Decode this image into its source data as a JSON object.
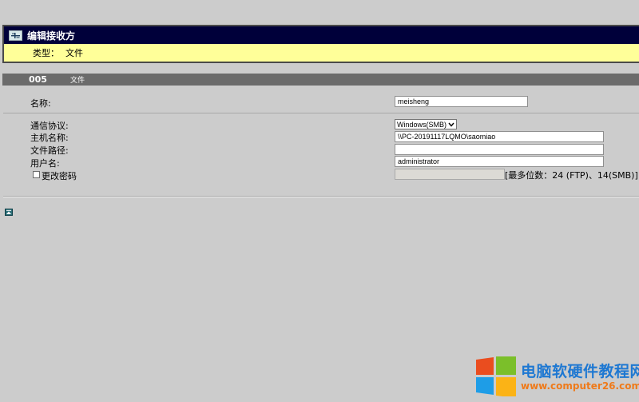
{
  "header": {
    "title": "编辑接收方",
    "type_label": "类型：",
    "type_value": "文件"
  },
  "section": {
    "number": "005",
    "kind": "文件"
  },
  "form": {
    "name_label": "名称:",
    "name_value": "meisheng",
    "protocol_label": "通信协议:",
    "protocol_value": "Windows(SMB)",
    "host_label": "主机名称:",
    "host_value": "\\\\PC-20191117LQMO\\saomiao",
    "path_label": "文件路径:",
    "path_value": "",
    "user_label": "用户名:",
    "user_value": "administrator",
    "change_password_label": "更改密码",
    "password_value": "",
    "password_hint": "[最多位数：24 (FTP)、14(SMB)]"
  },
  "watermark": {
    "title": "电脑软硬件教程网",
    "url": "www.computer26.com",
    "colors": {
      "title": "#1e78d2",
      "url": "#ef7a1a"
    }
  },
  "colors": {
    "title_bar": "#00003a",
    "type_row": "#ffff99",
    "section_bar": "#6b6b6b",
    "background": "#cccccc"
  },
  "icons": [
    "card-icon",
    "back-to-top-icon",
    "windows-logo-icon"
  ]
}
